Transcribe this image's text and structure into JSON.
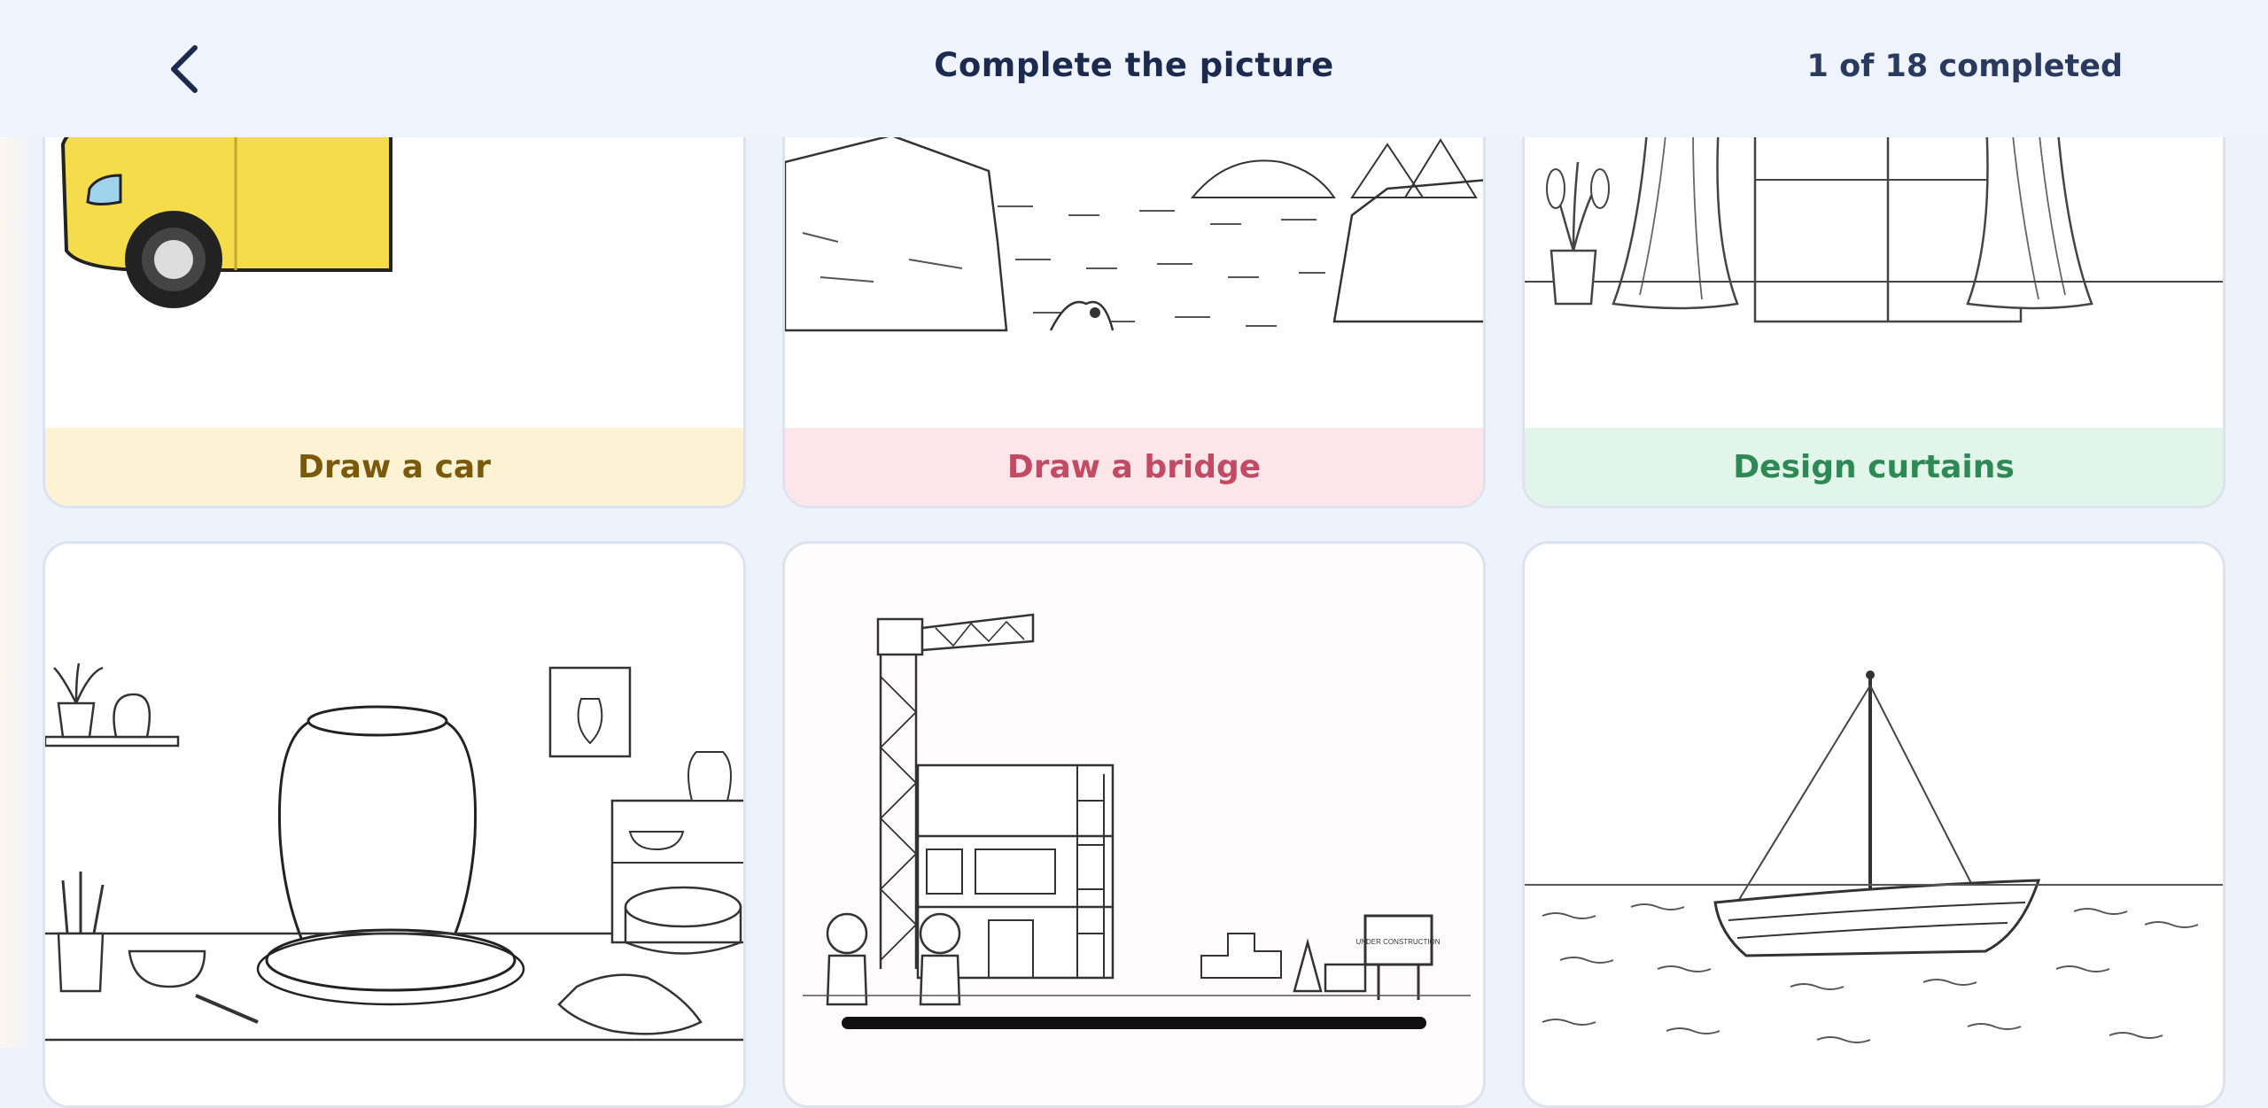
{
  "header": {
    "title": "Complete the picture",
    "progress_text": "1 of 18 completed",
    "back_icon": "chevron-left-icon"
  },
  "cards": [
    {
      "label": "Draw a car",
      "band_color": "#fdf2d4",
      "text_color": "#7a5a0a"
    },
    {
      "label": "Draw a bridge",
      "band_color": "#fde6ea",
      "text_color": "#c24a62"
    },
    {
      "label": "Design curtains",
      "band_color": "#e2f5ea",
      "text_color": "#2e8a55"
    },
    {
      "label": ""
    },
    {
      "label": ""
    },
    {
      "label": ""
    }
  ],
  "construction_sign": "UNDER CONSTRUCTION",
  "colors": {
    "background": "#eef3fb",
    "header_text": "#1b2a4e",
    "car_yellow": "#f5dc4a"
  }
}
